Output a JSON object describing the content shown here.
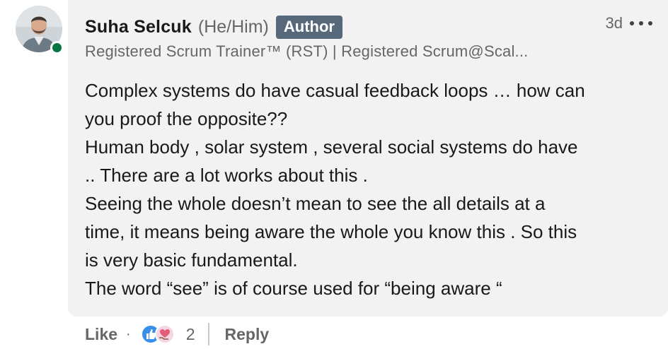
{
  "comment": {
    "author_name": "Suha Selcuk",
    "pronouns": "(He/Him)",
    "badge": "Author",
    "timestamp": "3d",
    "headline": "Registered Scrum Trainer™ (RST) | Registered Scrum@Scal...",
    "presence_color": "#057642",
    "body_lines": [
      "Complex systems do have casual feedback loops … how can",
      "you proof the opposite??",
      "Human body , solar system , several social systems do have",
      ".. There are a lot works about this .",
      "Seeing the whole doesn’t mean to see the all details at a",
      "time, it means being aware the whole you know this . So this",
      "is very basic fundamental.",
      "The word “see” is of course used for “being aware “"
    ]
  },
  "actions": {
    "like_label": "Like",
    "separator": "·",
    "reaction_icons": [
      "like-reaction-icon",
      "love-reaction-icon"
    ],
    "reaction_count": "2",
    "reply_label": "Reply"
  },
  "menu": {
    "icon": "more-options-icon"
  },
  "colors": {
    "bubble": "#f2f2f2",
    "badge": "#56687a",
    "secondary_text": "#666666",
    "like_blue": "#378fe9"
  }
}
